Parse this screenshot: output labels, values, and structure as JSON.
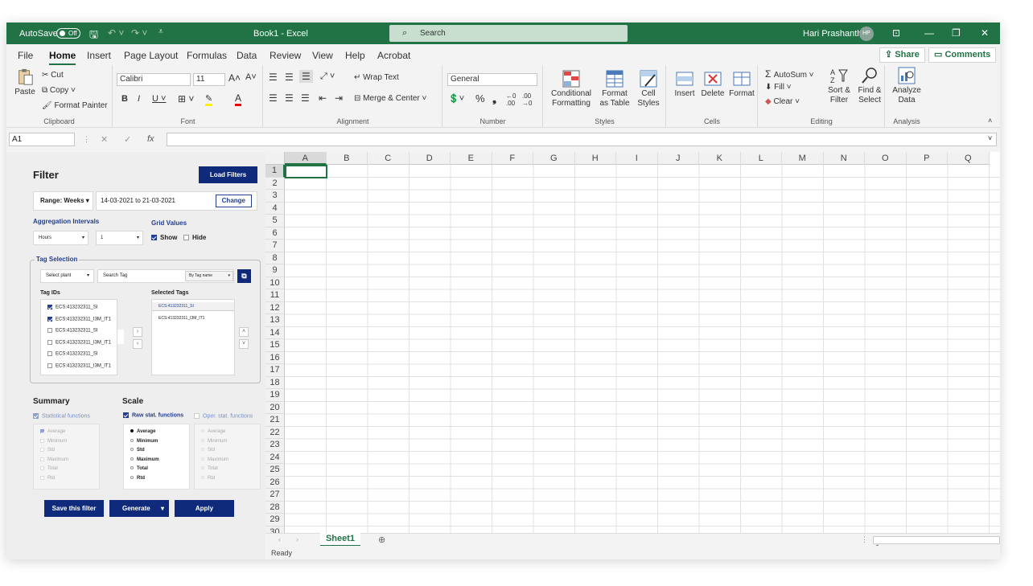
{
  "titlebar": {
    "autosave": "AutoSave",
    "toggle": "Off",
    "title": "Book1  -  Excel",
    "search": "Search",
    "user": "Hari Prashanth",
    "initials": "HP"
  },
  "menu": {
    "tabs": [
      "File",
      "Home",
      "Insert",
      "Page Layout",
      "Formulas",
      "Data",
      "Review",
      "View",
      "Help",
      "Acrobat"
    ],
    "share": "Share",
    "comments": "Comments"
  },
  "ribbon": {
    "clipboard": {
      "paste": "Paste",
      "cut": "Cut",
      "copy": "Copy",
      "format_painter": "Format Painter",
      "label": "Clipboard"
    },
    "font": {
      "name": "Calibri",
      "size": "11",
      "label": "Font"
    },
    "alignment": {
      "wrap": "Wrap Text",
      "merge": "Merge & Center",
      "label": "Alignment"
    },
    "number": {
      "format": "General",
      "label": "Number"
    },
    "styles": {
      "conditional": "Conditional Formatting",
      "table": "Format as Table",
      "cell": "Cell Styles",
      "label": "Styles"
    },
    "cells": {
      "insert": "Insert",
      "delete": "Delete",
      "format": "Format",
      "label": "Cells"
    },
    "editing": {
      "autosum": "AutoSum",
      "fill": "Fill",
      "clear": "Clear",
      "sort": "Sort & Filter",
      "find": "Find & Select",
      "label": "Editing"
    },
    "analysis": {
      "analyze": "Analyze Data",
      "label": "Analysis"
    }
  },
  "formula": {
    "namebox": "A1",
    "fx": "fx"
  },
  "panel": {
    "title": "Filter",
    "load_filters": "Load Filters",
    "range": "Range: Weeks",
    "date_range": "14-03-2021 to 21-03-2021",
    "change": "Change",
    "aggregation": "Aggregation Intervals",
    "agg_unit": "Hours",
    "agg_value": "1",
    "grid_values": "Grid Values",
    "show": "Show",
    "hide": "Hide",
    "tag_selection": "Tag Selection",
    "select_plant": "Select plant",
    "search_tag": "Search Tag",
    "by_tag": "By Tag name",
    "tag_ids": "Tag IDs",
    "tag_list": [
      {
        "label": "ECS:413232311_SI",
        "checked": true
      },
      {
        "label": "ECS:413232311_I3M_IT1",
        "checked": true
      },
      {
        "label": "ECS:413232311_SI",
        "checked": false
      },
      {
        "label": "ECS:413232311_I3M_IT1",
        "checked": false
      },
      {
        "label": "ECS:413232311_SI",
        "checked": false
      },
      {
        "label": "ECS:413232311_I3M_IT1",
        "checked": false
      }
    ],
    "selected_tags": "Selected Tags",
    "selected_list": [
      "ECS:413232311_SI",
      "ECS:413232311_I3M_IT1"
    ],
    "summary": "Summary",
    "scale": "Scale",
    "stat_functions": "Statistical functions",
    "raw_stat": "Raw stat. functions",
    "oper_stat": "Oper. stat. functions",
    "summary_items": [
      "Average",
      "Minimum",
      "Std",
      "Maximum",
      "Total",
      "Rtd"
    ],
    "raw_items": [
      "Average",
      "Minimum",
      "Std",
      "Maximum",
      "Total",
      "Rtd"
    ],
    "oper_items": [
      "Average",
      "Minimum",
      "Std",
      "Maximum",
      "Total",
      "Rtd"
    ],
    "save_filter": "Save this filter",
    "generate": "Generate",
    "apply": "Apply"
  },
  "grid": {
    "columns": [
      "A",
      "B",
      "C",
      "D",
      "E",
      "F",
      "G",
      "H",
      "I",
      "J",
      "K",
      "L",
      "M",
      "N",
      "O",
      "P",
      "Q"
    ],
    "rows": [
      "1",
      "2",
      "3",
      "4",
      "5",
      "6",
      "7",
      "8",
      "9",
      "10",
      "11",
      "12",
      "13",
      "14",
      "15",
      "16",
      "17",
      "18",
      "19",
      "20",
      "21",
      "22",
      "23",
      "24",
      "25",
      "26",
      "27",
      "28",
      "29",
      "30"
    ],
    "sheet": "Sheet1",
    "status": "Ready"
  },
  "colors": {
    "excel_green": "#217346",
    "navy": "#0f2a7a"
  }
}
